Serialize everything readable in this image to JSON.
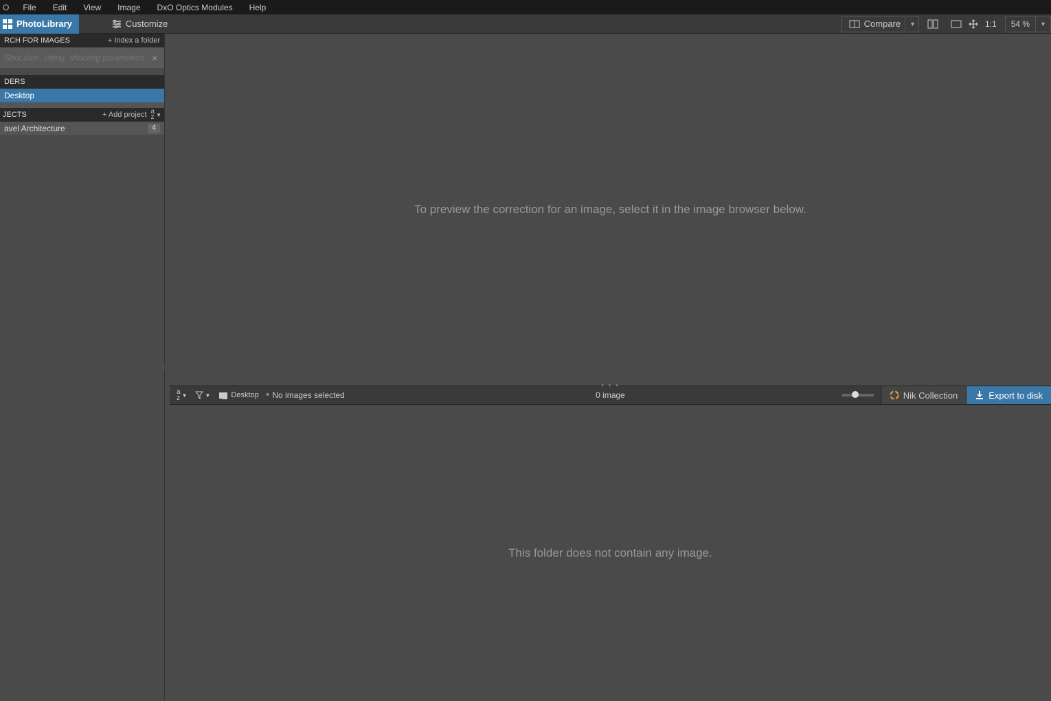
{
  "menubar": {
    "logo": "O",
    "items": [
      "File",
      "Edit",
      "View",
      "Image",
      "DxO Optics Modules",
      "Help"
    ]
  },
  "toolbar": {
    "photolibrary": "PhotoLibrary",
    "customize": "Customize",
    "compare": "Compare",
    "ratio": "1:1",
    "zoom": "54 %"
  },
  "sidebar": {
    "search_header": "RCH FOR IMAGES",
    "index_action": "+ Index a folder",
    "search_placeholder": "Shot date, rating, shooting parameters...",
    "folders_header": "DERS",
    "folder_item": "Desktop",
    "projects_header": "JECTS",
    "add_project": "+ Add project",
    "project_name": "avel Architecture",
    "project_count": "4"
  },
  "preview": {
    "message": "To preview the correction for an image, select it in the image browser below."
  },
  "browser_bar": {
    "path": "Desktop",
    "status": "No images selected",
    "count": "0 image",
    "nik": "Nik Collection",
    "export": "Export to disk"
  },
  "browser": {
    "message": "This folder does not contain any image."
  }
}
